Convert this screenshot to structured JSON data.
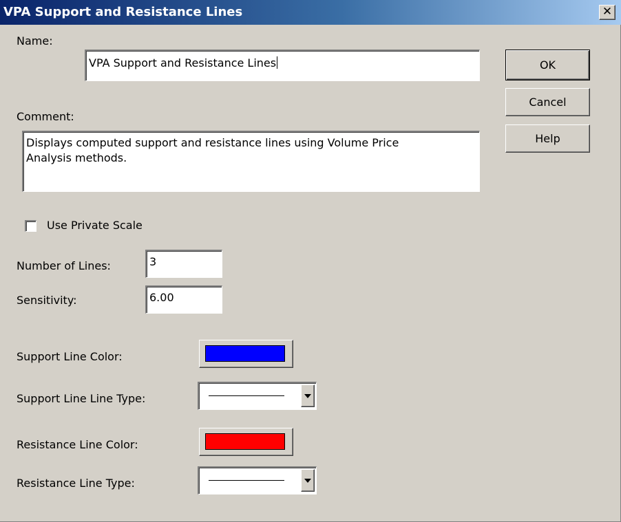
{
  "window": {
    "title": "VPA Support and Resistance Lines",
    "close_glyph": "✕"
  },
  "form": {
    "name_label": "Name:",
    "name_value": "VPA Support and Resistance Lines",
    "comment_label": "Comment:",
    "comment_line1": "Displays computed support and resistance lines using Volume Price",
    "comment_line2": "Analysis methods.",
    "private_scale_label": "Use Private Scale",
    "private_scale_checked": false,
    "number_of_lines_label": "Number of Lines:",
    "number_of_lines_value": "3",
    "sensitivity_label": "Sensitivity:",
    "sensitivity_value": "6.00",
    "support_color_label": "Support Line Color:",
    "support_color": "#0000ff",
    "support_type_label": "Support Line Line Type:",
    "support_type_value": "solid",
    "resistance_color_label": "Resistance Line Color:",
    "resistance_color": "#ff0000",
    "resistance_type_label": "Resistance Line Type:",
    "resistance_type_value": "solid"
  },
  "buttons": {
    "ok_label": "OK",
    "cancel_label": "Cancel",
    "help_label": "Help"
  },
  "icons": {
    "close": "close-icon",
    "dropdown": "chevron-down-icon"
  }
}
